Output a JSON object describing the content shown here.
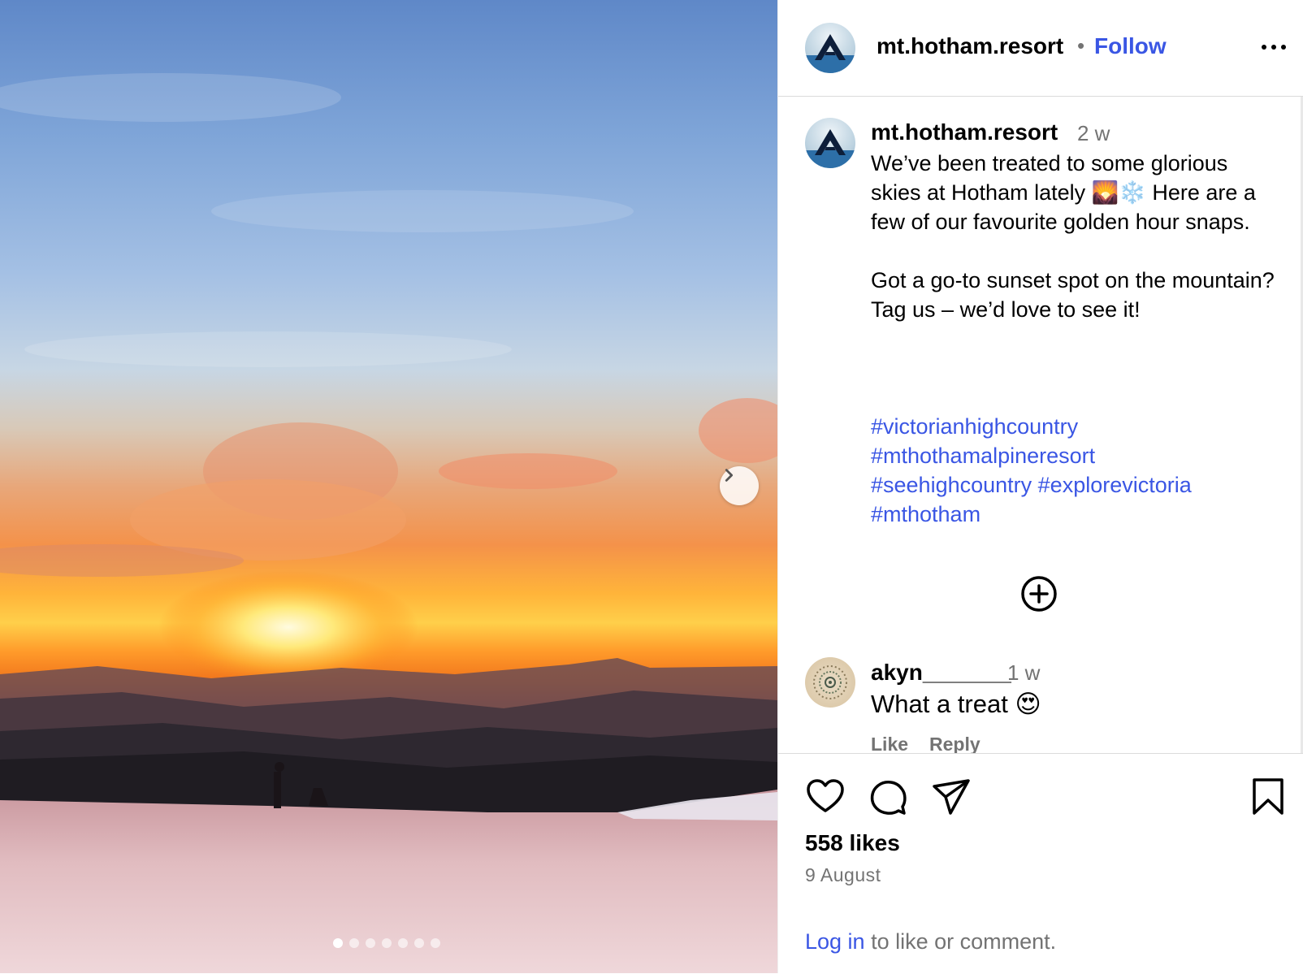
{
  "header": {
    "username": "mt.hotham.resort",
    "separator": "•",
    "follow_label": "Follow"
  },
  "caption": {
    "username": "mt.hotham.resort",
    "time": "2 w",
    "text": "We’ve been treated to some glorious skies at Hotham lately 🌄❄️ Here are a few of our favourite golden hour snaps.\n\nGot a go-to sunset spot on the mountain? Tag us – we’d love to see it!",
    "hashtags": [
      "#victorianhighcountry",
      "#mthothamalpineresort",
      "#seehighcountry",
      "#explorevictoria",
      "#mthotham"
    ]
  },
  "comment": {
    "username": "akyn_______",
    "time": "1 w",
    "text": "What a treat 😍",
    "like_label": "Like",
    "reply_label": "Reply"
  },
  "engagement": {
    "likes": "558 likes",
    "date": "9 August"
  },
  "footer": {
    "login_link": "Log in",
    "login_rest": " to like or comment."
  },
  "carousel": {
    "total_slides": 7,
    "active_slide": 1
  },
  "colors": {
    "link": "#3a56e4",
    "muted": "#737373"
  }
}
